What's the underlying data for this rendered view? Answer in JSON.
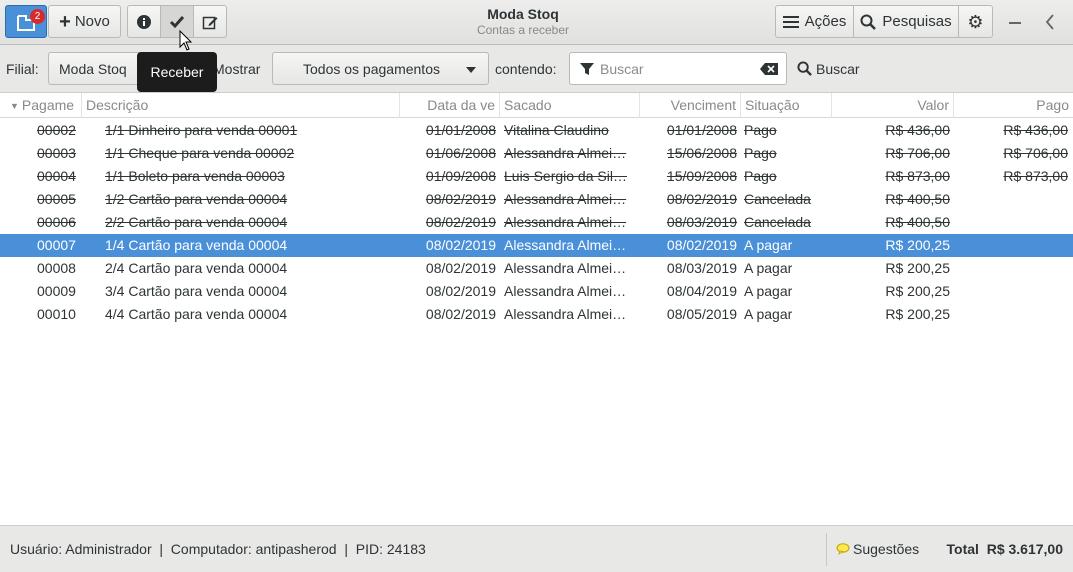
{
  "header": {
    "title": "Moda Stoq",
    "subtitle": "Contas a receber",
    "launcher_badge": "2",
    "new_button_label": "Novo",
    "actions_label": "Ações",
    "search_label": "Pesquisas",
    "icons": {
      "launcher": "launcher-icon",
      "new": "plus-icon",
      "info": "info-icon",
      "receive": "check-icon",
      "edit": "edit-icon",
      "actions": "hamburger-menu-icon",
      "search": "magnifier-icon",
      "settings": "gear-icon",
      "minimize": "minimize-icon",
      "back": "chevron-left-icon"
    }
  },
  "tooltip": {
    "text": "Receber"
  },
  "filter": {
    "branch_label": "Filial:",
    "branch_value": "Moda Stoq",
    "show_label": "Mostrar",
    "show_value": "Todos os pagamentos",
    "containing_label": "contendo:",
    "search_placeholder": "Buscar",
    "search_button_label": "Buscar"
  },
  "table": {
    "columns": [
      "Pagame",
      "Descrição",
      "Data da ve",
      "Sacado",
      "Venciment",
      "Situação",
      "Valor",
      "Pago"
    ],
    "rows": [
      {
        "id": "00002",
        "desc": "1/1 Dinheiro para venda 00001",
        "date": "01/01/2008",
        "payer": "Vitalina Claudino",
        "due": "01/01/2008",
        "status": "Pago",
        "value": "R$ 436,00",
        "paid": "R$ 436,00",
        "strike": true,
        "selected": false
      },
      {
        "id": "00003",
        "desc": "1/1 Cheque para venda 00002",
        "date": "01/06/2008",
        "payer": "Alessandra Almei…",
        "due": "15/06/2008",
        "status": "Pago",
        "value": "R$ 706,00",
        "paid": "R$ 706,00",
        "strike": true,
        "selected": false
      },
      {
        "id": "00004",
        "desc": "1/1 Boleto para venda 00003",
        "date": "01/09/2008",
        "payer": "Luis Sergio da Sil…",
        "due": "15/09/2008",
        "status": "Pago",
        "value": "R$ 873,00",
        "paid": "R$ 873,00",
        "strike": true,
        "selected": false
      },
      {
        "id": "00005",
        "desc": "1/2 Cartão para venda 00004",
        "date": "08/02/2019",
        "payer": "Alessandra Almei…",
        "due": "08/02/2019",
        "status": "Cancelada",
        "value": "R$ 400,50",
        "paid": "",
        "strike": true,
        "selected": false
      },
      {
        "id": "00006",
        "desc": "2/2 Cartão para venda 00004",
        "date": "08/02/2019",
        "payer": "Alessandra Almei…",
        "due": "08/03/2019",
        "status": "Cancelada",
        "value": "R$ 400,50",
        "paid": "",
        "strike": true,
        "selected": false
      },
      {
        "id": "00007",
        "desc": "1/4 Cartão para venda 00004",
        "date": "08/02/2019",
        "payer": "Alessandra Almei…",
        "due": "08/02/2019",
        "status": "A pagar",
        "value": "R$ 200,25",
        "paid": "",
        "strike": false,
        "selected": true
      },
      {
        "id": "00008",
        "desc": "2/4 Cartão para venda 00004",
        "date": "08/02/2019",
        "payer": "Alessandra Almei…",
        "due": "08/03/2019",
        "status": "A pagar",
        "value": "R$ 200,25",
        "paid": "",
        "strike": false,
        "selected": false
      },
      {
        "id": "00009",
        "desc": "3/4 Cartão para venda 00004",
        "date": "08/02/2019",
        "payer": "Alessandra Almei…",
        "due": "08/04/2019",
        "status": "A pagar",
        "value": "R$ 200,25",
        "paid": "",
        "strike": false,
        "selected": false
      },
      {
        "id": "00010",
        "desc": "4/4 Cartão para venda 00004",
        "date": "08/02/2019",
        "payer": "Alessandra Almei…",
        "due": "08/05/2019",
        "status": "A pagar",
        "value": "R$ 200,25",
        "paid": "",
        "strike": false,
        "selected": false
      }
    ]
  },
  "status": {
    "info": "Usuário: Administrador  |  Computador: antipasherod  |  PID: 24183",
    "suggestions_label": "Sugestões",
    "total_label": "Total",
    "total_value": "R$ 3.617,00"
  },
  "colors": {
    "accent": "#4a90d9",
    "badge": "#d62b2b"
  }
}
